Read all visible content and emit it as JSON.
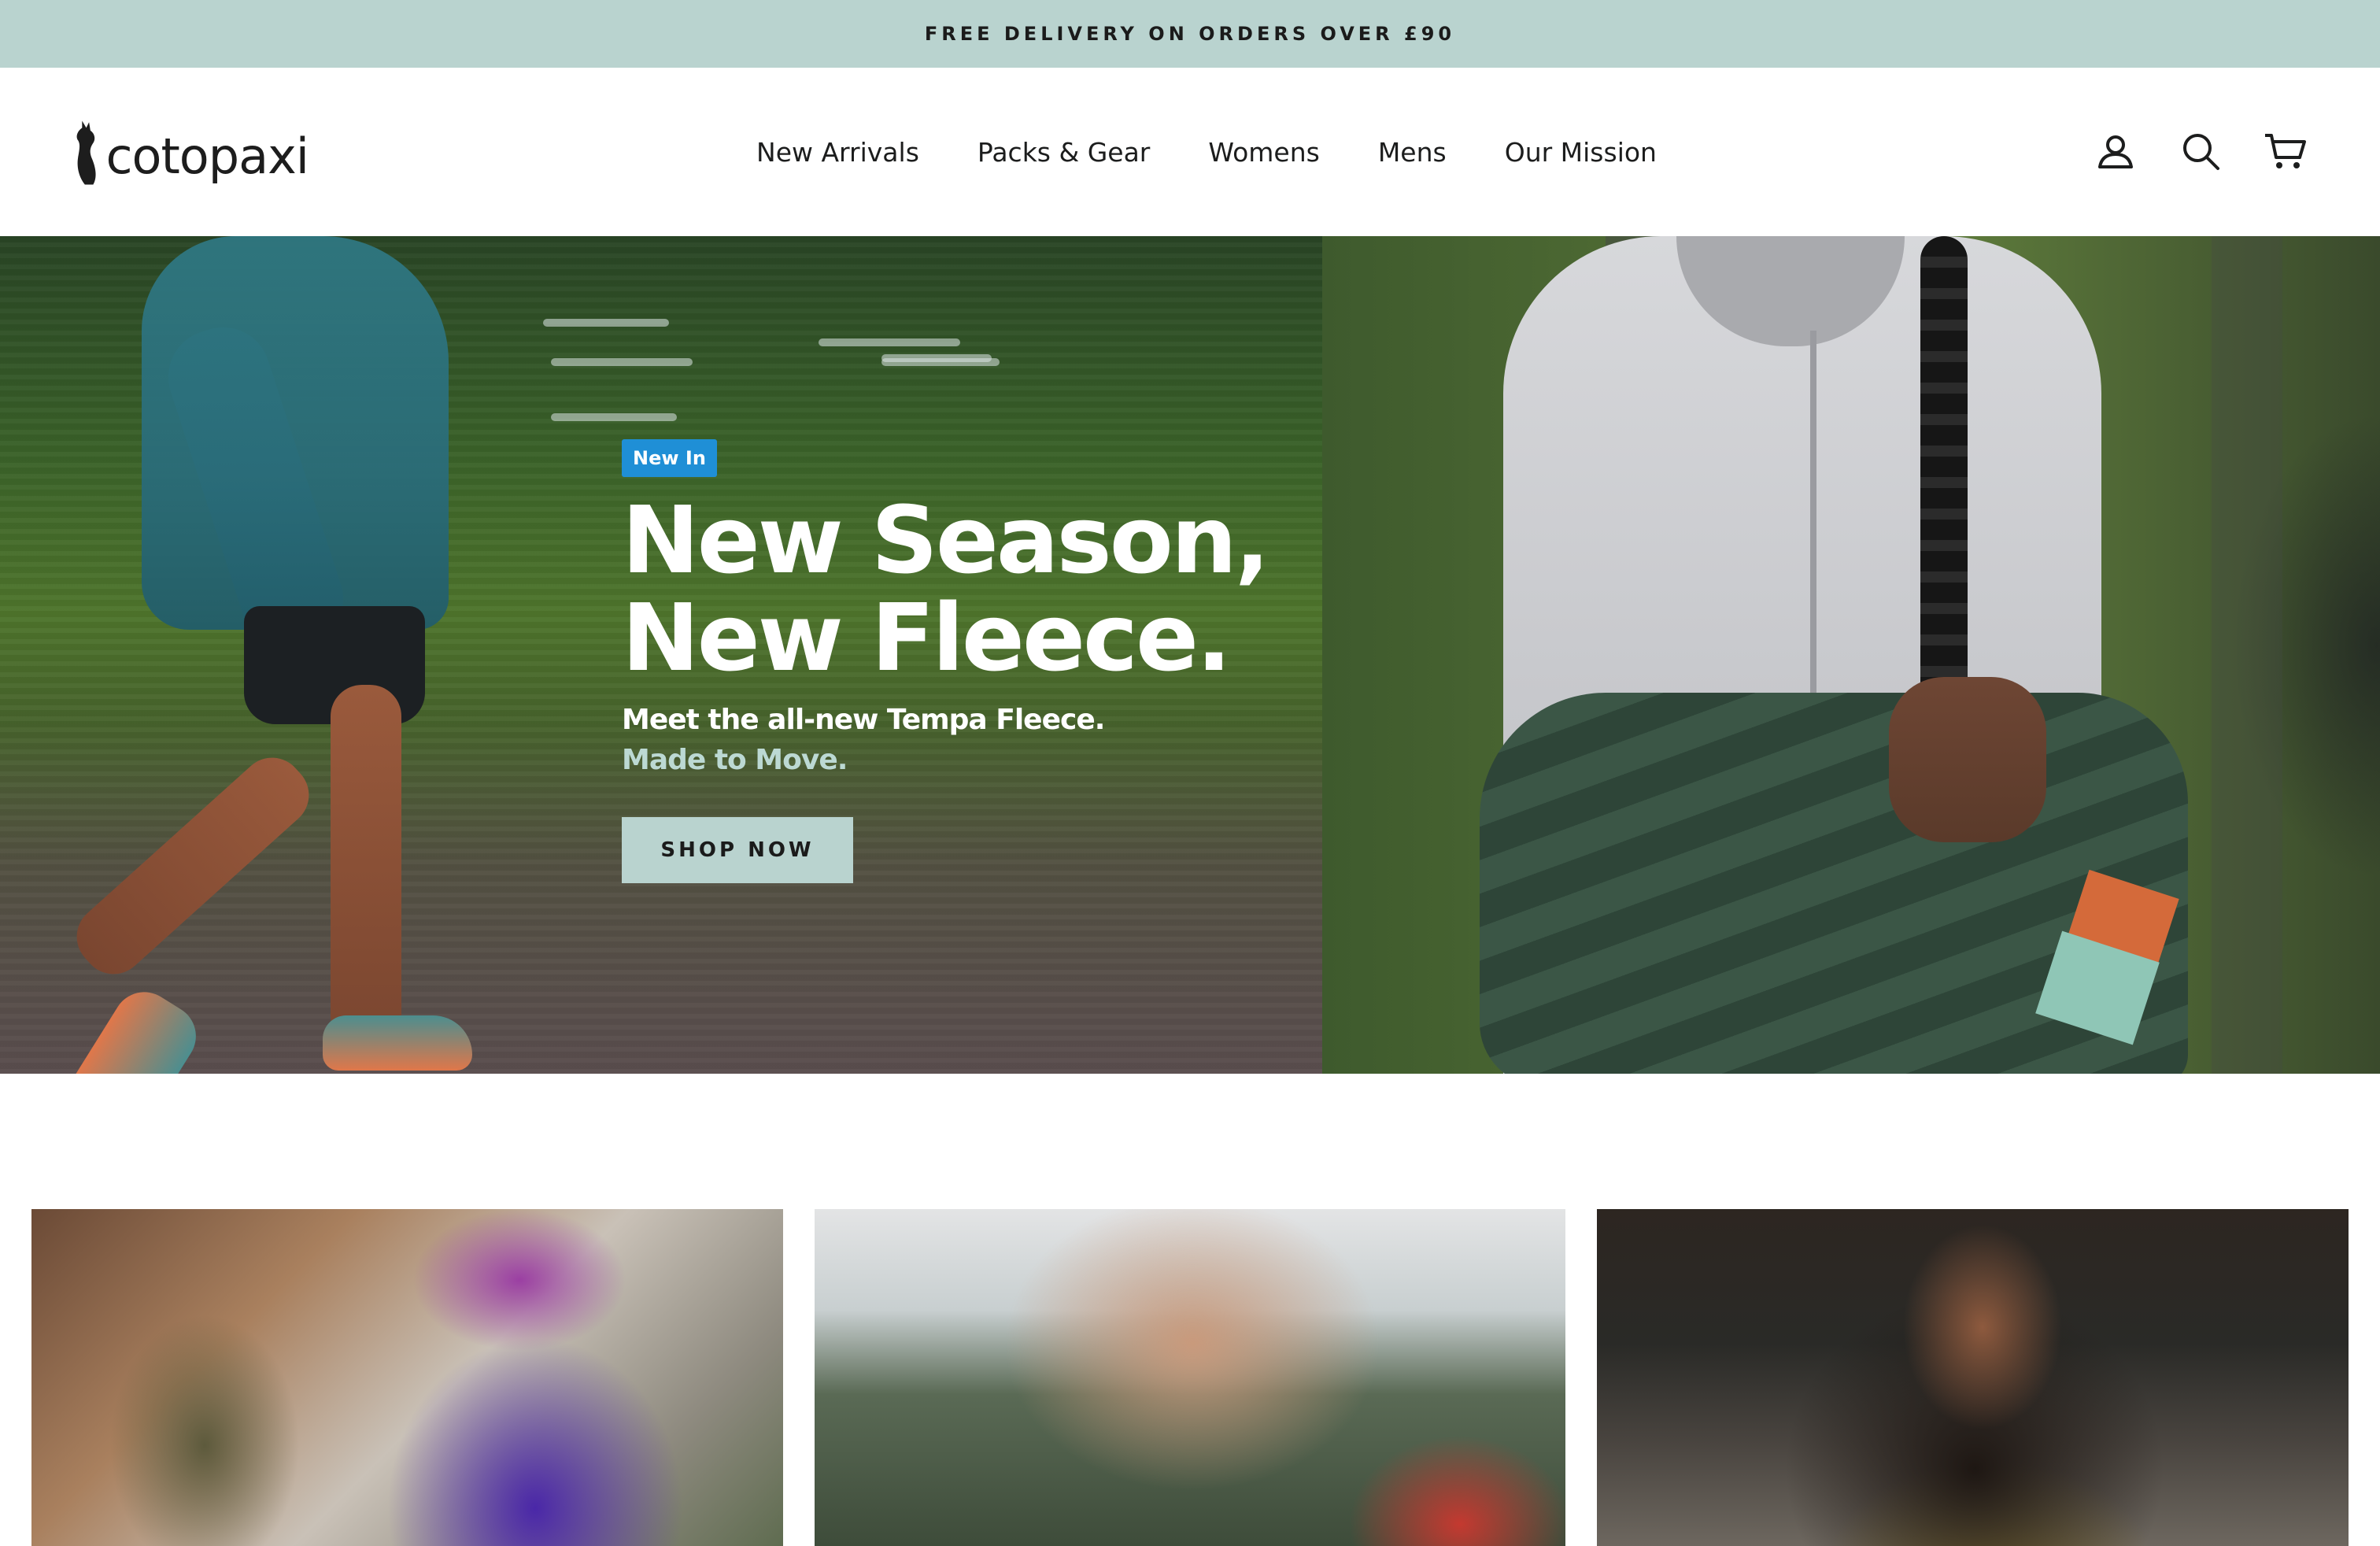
{
  "announcement": {
    "text": "FREE DELIVERY ON ORDERS OVER £90"
  },
  "header": {
    "logo_text": "cotopaxi",
    "nav": [
      {
        "label": "New Arrivals"
      },
      {
        "label": "Packs & Gear"
      },
      {
        "label": "Womens"
      },
      {
        "label": "Mens"
      },
      {
        "label": "Our Mission"
      }
    ],
    "icons": [
      "account-icon",
      "search-icon",
      "cart-icon"
    ]
  },
  "hero": {
    "badge": "New In",
    "title_line1": "New Season,",
    "title_line2": "New Fleece.",
    "subtitle": "Meet the all-new Tempa Fleece.",
    "tagline": "Made to Move.",
    "cta": "SHOP NOW"
  },
  "colors": {
    "announcement_bg": "#b9d3cf",
    "badge_bg": "#1f8fd6",
    "cta_bg": "#b9d3cf",
    "tagline": "#bcd9d3"
  }
}
